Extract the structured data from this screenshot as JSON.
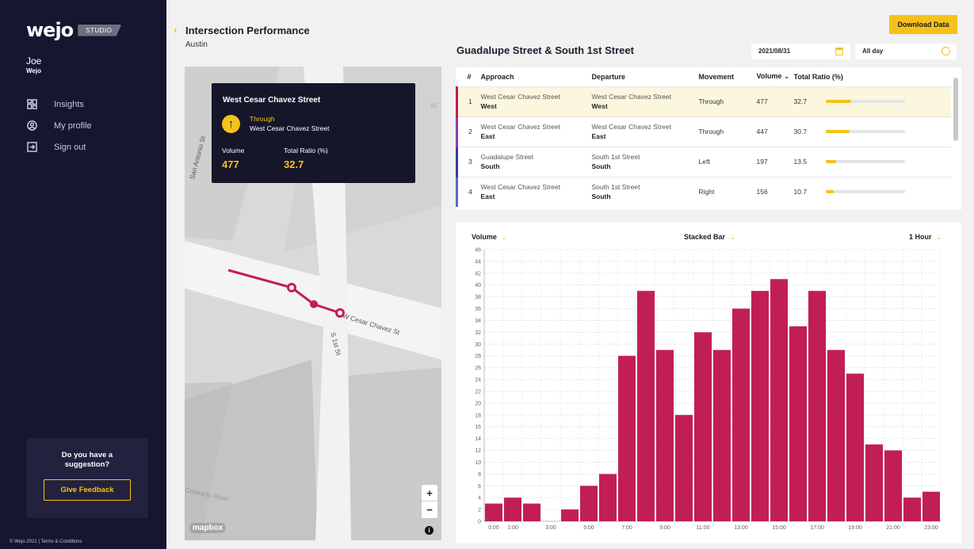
{
  "sidebar": {
    "logo": "wejo",
    "logo_badge": "STUDIO",
    "user_name": "Joe",
    "user_org": "Wejo",
    "nav": [
      {
        "label": "Insights",
        "icon": "grid-icon"
      },
      {
        "label": "My profile",
        "icon": "user-circle-icon"
      },
      {
        "label": "Sign out",
        "icon": "sign-out-icon"
      }
    ],
    "suggestion_prompt": "Do you have a suggestion?",
    "feedback_button": "Give Feedback",
    "footer": "© Wejo 2021  |  Terms & Conditions"
  },
  "header": {
    "title": "Intersection Performance",
    "city": "Austin",
    "download_button": "Download Data",
    "intersection": "Guadalupe Street & South 1st Street",
    "date": "2021/08/31",
    "time_range": "All day"
  },
  "map": {
    "tooltip": {
      "street": "West Cesar Chavez Street",
      "movement": "Through",
      "departure": "West Cesar Chavez Street",
      "volume_label": "Volume",
      "volume_value": "477",
      "ratio_label": "Total Ratio (%)",
      "ratio_value": "32.7"
    },
    "labels": {
      "road1": "W Cesar Chavez St",
      "road2": "S 1st St",
      "road3": "San Antonio St",
      "river": "Colorado River",
      "clip": "W"
    },
    "zoom_in": "+",
    "zoom_out": "−",
    "attribution": "mapbox",
    "info": "i"
  },
  "table": {
    "headers": [
      "#",
      "Approach",
      "Departure",
      "Movement",
      "Volume",
      "Total Ratio (%)"
    ],
    "sort_indicator": "⌄",
    "rows": [
      {
        "idx": "1",
        "approach": "West Cesar Chavez Street",
        "approach_dir": "West",
        "departure": "West Cesar Chavez Street",
        "departure_dir": "West",
        "movement": "Through",
        "volume": "477",
        "ratio": "32.7",
        "ratio_frac": 0.327,
        "accent": "#c21e56"
      },
      {
        "idx": "2",
        "approach": "West Cesar Chavez Street",
        "approach_dir": "East",
        "departure": "West Cesar Chavez Street",
        "departure_dir": "East",
        "movement": "Through",
        "volume": "447",
        "ratio": "30.7",
        "ratio_frac": 0.307,
        "accent": "#8b3fa7"
      },
      {
        "idx": "3",
        "approach": "Guadalupe Street",
        "approach_dir": "South",
        "departure": "South 1st Street",
        "departure_dir": "South",
        "movement": "Left",
        "volume": "197",
        "ratio": "13.5",
        "ratio_frac": 0.135,
        "accent": "#3b3b9e"
      },
      {
        "idx": "4",
        "approach": "West Cesar Chavez Street",
        "approach_dir": "East",
        "departure": "South 1st Street",
        "departure_dir": "South",
        "movement": "Right",
        "volume": "156",
        "ratio": "10.7",
        "ratio_frac": 0.107,
        "accent": "#4f6fc4"
      }
    ]
  },
  "chart_controls": {
    "metric": "Volume",
    "chart_type": "Stacked Bar",
    "interval": "1 Hour"
  },
  "colors": {
    "accent": "#f5c21b",
    "bar": "#c21e56",
    "sidebar": "#161630"
  },
  "chart_data": {
    "type": "bar",
    "categories": [
      "0:00",
      "1:00",
      "2:00",
      "3:00",
      "4:00",
      "5:00",
      "6:00",
      "7:00",
      "8:00",
      "9:00",
      "10:00",
      "11:00",
      "12:00",
      "13:00",
      "14:00",
      "15:00",
      "16:00",
      "17:00",
      "18:00",
      "19:00",
      "20:00",
      "21:00",
      "22:00",
      "23:00"
    ],
    "tick_labels": [
      "0:00",
      "1:00",
      "",
      "3:00",
      "",
      "5:00",
      "",
      "7:00",
      "",
      "9:00",
      "",
      "11:00",
      "",
      "13:00",
      "",
      "15:00",
      "",
      "17:00",
      "",
      "19:00",
      "",
      "21:00",
      "",
      "23:00"
    ],
    "values": [
      3,
      4,
      3,
      0,
      2,
      6,
      8,
      28,
      39,
      29,
      18,
      32,
      29,
      36,
      39,
      41,
      33,
      39,
      29,
      25,
      13,
      12,
      4,
      5
    ],
    "ylim": [
      0,
      46
    ],
    "yticks": [
      0,
      2,
      4,
      6,
      8,
      10,
      12,
      14,
      16,
      18,
      20,
      22,
      24,
      26,
      28,
      30,
      32,
      34,
      36,
      38,
      40,
      42,
      44,
      46
    ],
    "grid": true
  }
}
